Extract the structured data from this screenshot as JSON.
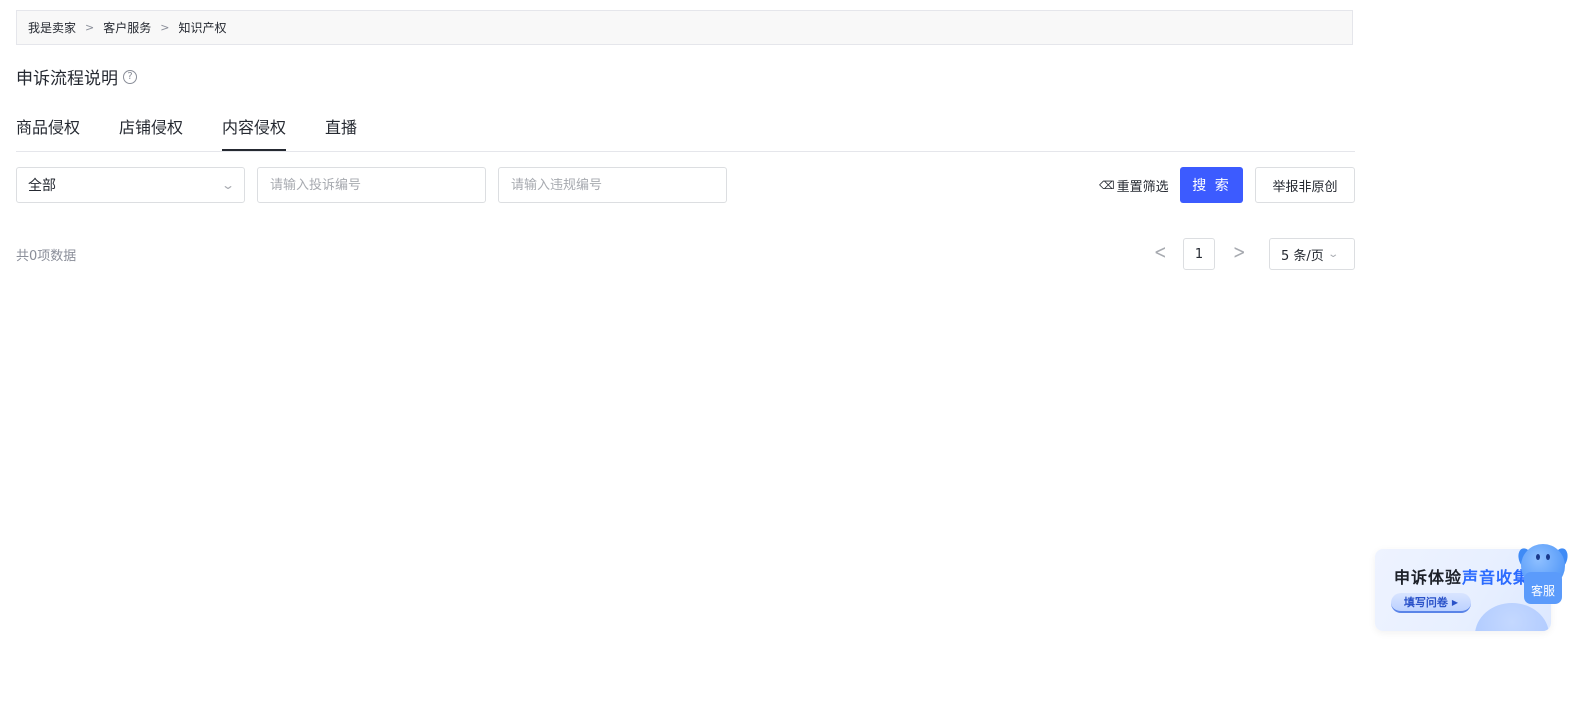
{
  "breadcrumb": [
    "我是卖家",
    "客户服务",
    "知识产权"
  ],
  "breadcrumb_sep": ">",
  "page_title": "申诉流程说明",
  "help_icon": "?",
  "tabs": [
    {
      "label": "商品侵权",
      "active": false
    },
    {
      "label": "店铺侵权",
      "active": false
    },
    {
      "label": "内容侵权",
      "active": true
    },
    {
      "label": "直播",
      "active": false
    }
  ],
  "filters": {
    "type_select": {
      "value": "全部",
      "icon": "chevron-down-icon"
    },
    "complaint_no": {
      "placeholder": "请输入投诉编号",
      "value": ""
    },
    "violation_no": {
      "placeholder": "请输入违规编号",
      "value": ""
    }
  },
  "actions": {
    "reset_label": "重置筛选",
    "reset_icon": "eraser-icon",
    "search_label": "搜 索",
    "report_label": "举报非原创"
  },
  "list": {
    "total_text": "共0项数据"
  },
  "pagination": {
    "prev": "<",
    "next": ">",
    "current_page": "1",
    "page_size": "5 条/页"
  },
  "feedback_banner": {
    "title_part1": "申诉体验",
    "title_part2": "声音收集",
    "button_label": "填写问卷",
    "play_icon": "▶"
  },
  "service": {
    "label": "客服"
  },
  "colors": {
    "primary": "#3c5bff",
    "text": "#252931",
    "muted": "#8a8e99",
    "border": "#dcdee1"
  }
}
